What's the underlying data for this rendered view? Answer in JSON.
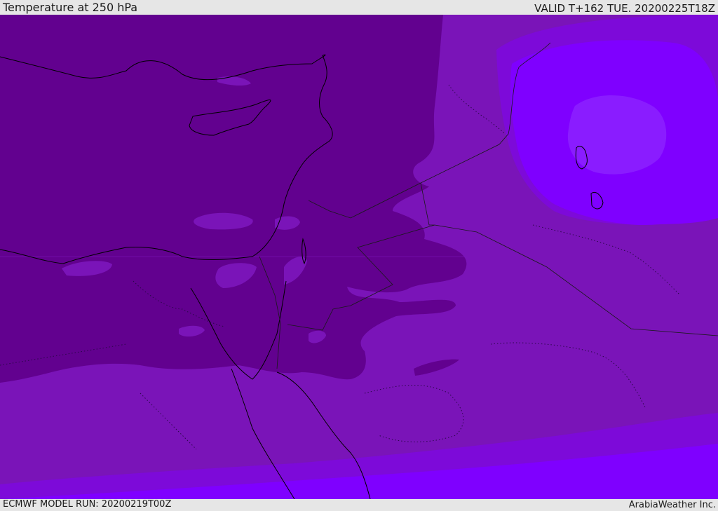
{
  "header": {
    "title": "Temperature at 250 hPa",
    "valid": "VALID T+162 TUE. 20200225T18Z"
  },
  "footer": {
    "model_run": "ECMWF MODEL RUN: 20200219T00Z",
    "credit": "ArabiaWeather Inc."
  },
  "colors": {
    "band_darkest": "#62018f",
    "band_mid": "#7a14b8",
    "band_light": "#7d0ad9",
    "band_bright": "#7f00ff",
    "band_core": "#8a1cff",
    "coastline": "#000000",
    "border": "#1a1a1a"
  }
}
